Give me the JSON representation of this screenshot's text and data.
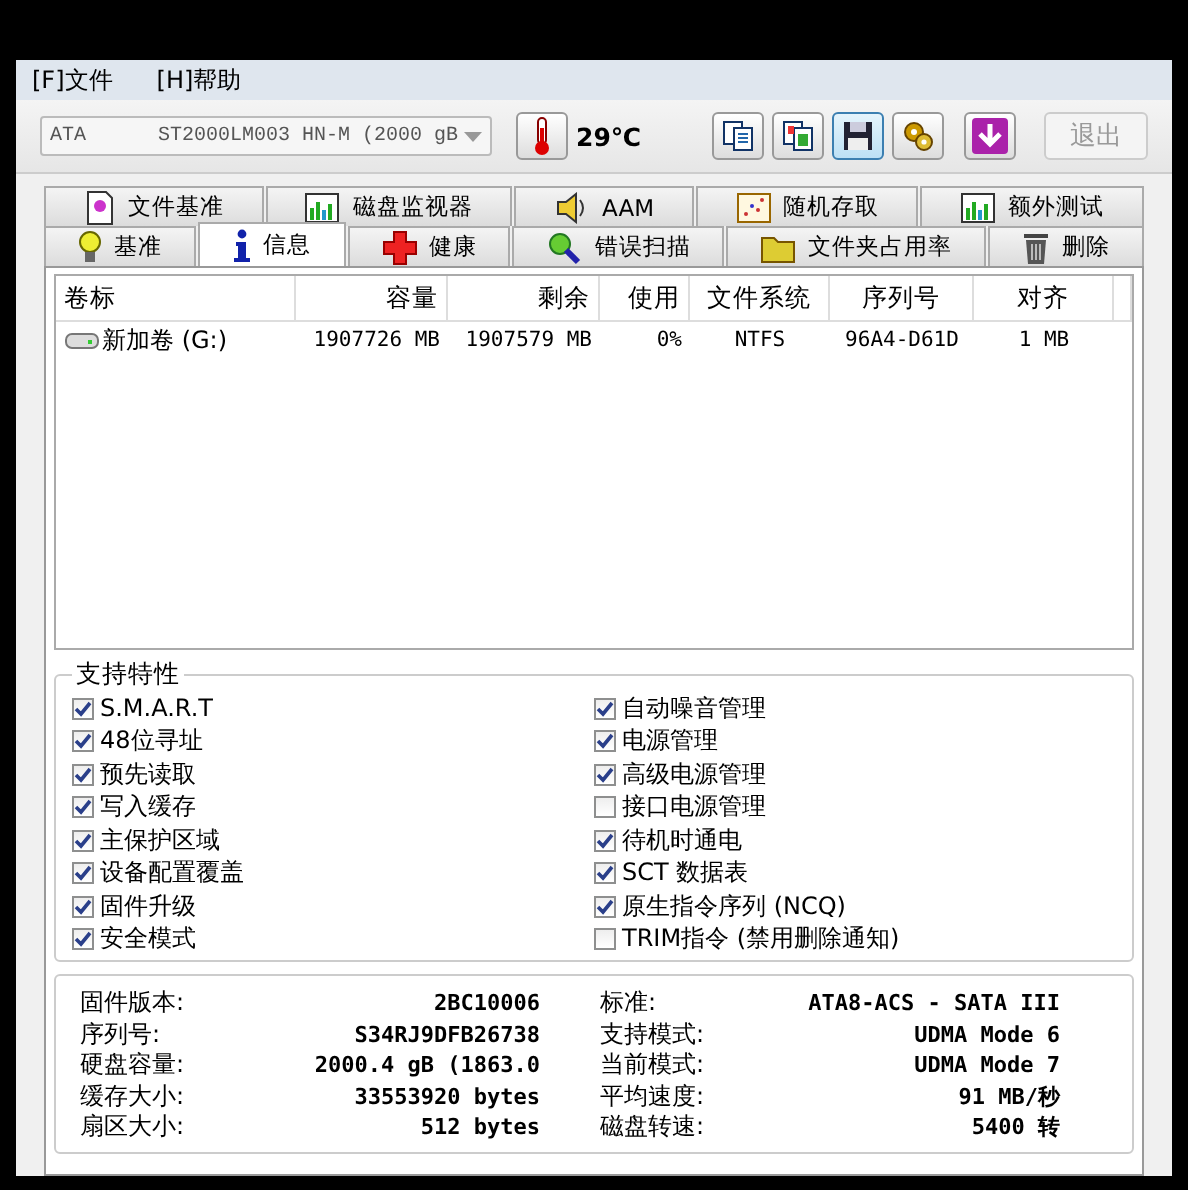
{
  "menu": [
    "[F]文件",
    "[H]帮助"
  ],
  "toolbar": {
    "device": "ATA      ST2000LM003 HN-M (2000 gB",
    "temperature": "29℃",
    "tool_buttons": [
      {
        "kind": "copy",
        "selected": false
      },
      {
        "kind": "copy-color",
        "selected": false
      },
      {
        "kind": "save",
        "selected": true
      },
      {
        "kind": "options",
        "selected": false
      },
      {
        "kind": "download",
        "selected": false
      }
    ],
    "exit_button": {
      "label": "退出",
      "disabled": true
    }
  },
  "tab_rows": [
    [
      {
        "label": "文件基准",
        "kind": "file",
        "selected": false
      },
      {
        "label": "磁盘监视器",
        "kind": "monitor",
        "selected": false
      },
      {
        "label": "AAM",
        "kind": "speaker",
        "selected": false
      },
      {
        "label": "随机存取",
        "kind": "scatter",
        "selected": false
      },
      {
        "label": "额外测试",
        "kind": "extra",
        "selected": false
      }
    ],
    [
      {
        "label": "基准",
        "kind": "bulb",
        "selected": false
      },
      {
        "label": "信息",
        "kind": "info",
        "selected": true
      },
      {
        "label": "健康",
        "kind": "cross",
        "selected": false
      },
      {
        "label": "错误扫描",
        "kind": "magnifier",
        "selected": false
      },
      {
        "label": "文件夹占用率",
        "kind": "folder",
        "selected": false
      },
      {
        "label": "删除",
        "kind": "trash",
        "selected": false
      }
    ]
  ],
  "table": {
    "columns": [
      "卷标",
      "容量",
      "剩余",
      "使用",
      "文件系统",
      "序列号",
      "对齐"
    ],
    "rows": [
      [
        "新加卷 (G:)",
        "1907726 MB",
        "1907579 MB",
        "0%",
        "NTFS",
        "96A4-D61D",
        "1 MB"
      ]
    ]
  },
  "features": {
    "title": "支持特性",
    "items": [
      {
        "label": "S.M.A.R.T",
        "checked": true
      },
      {
        "label": "自动噪音管理",
        "checked": true
      },
      {
        "label": "48位寻址",
        "checked": true
      },
      {
        "label": "电源管理",
        "checked": true
      },
      {
        "label": "预先读取",
        "checked": true
      },
      {
        "label": "高级电源管理",
        "checked": true
      },
      {
        "label": "写入缓存",
        "checked": true
      },
      {
        "label": "接口电源管理",
        "checked": false
      },
      {
        "label": "主保护区域",
        "checked": true
      },
      {
        "label": "待机时通电",
        "checked": true
      },
      {
        "label": "设备配置覆盖",
        "checked": true
      },
      {
        "label": "SCT 数据表",
        "checked": true
      },
      {
        "label": "固件升级",
        "checked": true
      },
      {
        "label": "原生指令序列 (NCQ)",
        "checked": true
      },
      {
        "label": "安全模式",
        "checked": true
      },
      {
        "label": "TRIM指令 (禁用删除通知)",
        "checked": false
      }
    ]
  },
  "details": [
    {
      "label": "固件版本:",
      "value": "2BC10006"
    },
    {
      "label": "标准:",
      "value": "ATA8-ACS - SATA III"
    },
    {
      "label": "序列号:",
      "value": "S34RJ9DFB26738"
    },
    {
      "label": "支持模式:",
      "value": "UDMA Mode 6"
    },
    {
      "label": "硬盘容量:",
      "value": "2000.4 gB (1863.0"
    },
    {
      "label": "当前模式:",
      "value": "UDMA Mode 7"
    },
    {
      "label": "缓存大小:",
      "value": "33553920 bytes"
    },
    {
      "label": "平均速度:",
      "value": "91 MB/秒"
    },
    {
      "label": "扇区大小:",
      "value": "512 bytes"
    },
    {
      "label": "磁盘转速:",
      "value": "5400 转"
    }
  ]
}
